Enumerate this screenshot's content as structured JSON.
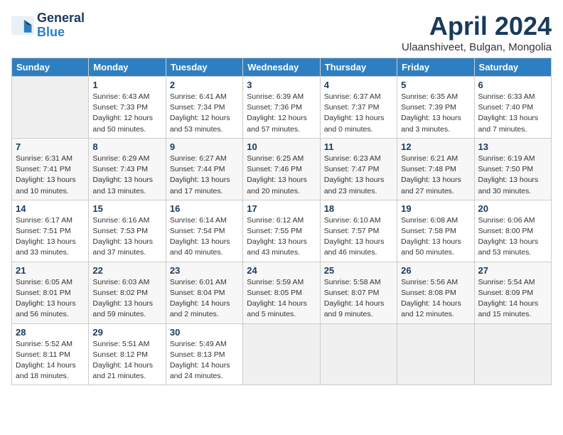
{
  "header": {
    "logo_line1": "General",
    "logo_line2": "Blue",
    "title": "April 2024",
    "subtitle": "Ulaanshiveet, Bulgan, Mongolia"
  },
  "weekdays": [
    "Sunday",
    "Monday",
    "Tuesday",
    "Wednesday",
    "Thursday",
    "Friday",
    "Saturday"
  ],
  "weeks": [
    [
      {
        "day": "",
        "info": ""
      },
      {
        "day": "1",
        "info": "Sunrise: 6:43 AM\nSunset: 7:33 PM\nDaylight: 12 hours\nand 50 minutes."
      },
      {
        "day": "2",
        "info": "Sunrise: 6:41 AM\nSunset: 7:34 PM\nDaylight: 12 hours\nand 53 minutes."
      },
      {
        "day": "3",
        "info": "Sunrise: 6:39 AM\nSunset: 7:36 PM\nDaylight: 12 hours\nand 57 minutes."
      },
      {
        "day": "4",
        "info": "Sunrise: 6:37 AM\nSunset: 7:37 PM\nDaylight: 13 hours\nand 0 minutes."
      },
      {
        "day": "5",
        "info": "Sunrise: 6:35 AM\nSunset: 7:39 PM\nDaylight: 13 hours\nand 3 minutes."
      },
      {
        "day": "6",
        "info": "Sunrise: 6:33 AM\nSunset: 7:40 PM\nDaylight: 13 hours\nand 7 minutes."
      }
    ],
    [
      {
        "day": "7",
        "info": "Sunrise: 6:31 AM\nSunset: 7:41 PM\nDaylight: 13 hours\nand 10 minutes."
      },
      {
        "day": "8",
        "info": "Sunrise: 6:29 AM\nSunset: 7:43 PM\nDaylight: 13 hours\nand 13 minutes."
      },
      {
        "day": "9",
        "info": "Sunrise: 6:27 AM\nSunset: 7:44 PM\nDaylight: 13 hours\nand 17 minutes."
      },
      {
        "day": "10",
        "info": "Sunrise: 6:25 AM\nSunset: 7:46 PM\nDaylight: 13 hours\nand 20 minutes."
      },
      {
        "day": "11",
        "info": "Sunrise: 6:23 AM\nSunset: 7:47 PM\nDaylight: 13 hours\nand 23 minutes."
      },
      {
        "day": "12",
        "info": "Sunrise: 6:21 AM\nSunset: 7:48 PM\nDaylight: 13 hours\nand 27 minutes."
      },
      {
        "day": "13",
        "info": "Sunrise: 6:19 AM\nSunset: 7:50 PM\nDaylight: 13 hours\nand 30 minutes."
      }
    ],
    [
      {
        "day": "14",
        "info": "Sunrise: 6:17 AM\nSunset: 7:51 PM\nDaylight: 13 hours\nand 33 minutes."
      },
      {
        "day": "15",
        "info": "Sunrise: 6:16 AM\nSunset: 7:53 PM\nDaylight: 13 hours\nand 37 minutes."
      },
      {
        "day": "16",
        "info": "Sunrise: 6:14 AM\nSunset: 7:54 PM\nDaylight: 13 hours\nand 40 minutes."
      },
      {
        "day": "17",
        "info": "Sunrise: 6:12 AM\nSunset: 7:55 PM\nDaylight: 13 hours\nand 43 minutes."
      },
      {
        "day": "18",
        "info": "Sunrise: 6:10 AM\nSunset: 7:57 PM\nDaylight: 13 hours\nand 46 minutes."
      },
      {
        "day": "19",
        "info": "Sunrise: 6:08 AM\nSunset: 7:58 PM\nDaylight: 13 hours\nand 50 minutes."
      },
      {
        "day": "20",
        "info": "Sunrise: 6:06 AM\nSunset: 8:00 PM\nDaylight: 13 hours\nand 53 minutes."
      }
    ],
    [
      {
        "day": "21",
        "info": "Sunrise: 6:05 AM\nSunset: 8:01 PM\nDaylight: 13 hours\nand 56 minutes."
      },
      {
        "day": "22",
        "info": "Sunrise: 6:03 AM\nSunset: 8:02 PM\nDaylight: 13 hours\nand 59 minutes."
      },
      {
        "day": "23",
        "info": "Sunrise: 6:01 AM\nSunset: 8:04 PM\nDaylight: 14 hours\nand 2 minutes."
      },
      {
        "day": "24",
        "info": "Sunrise: 5:59 AM\nSunset: 8:05 PM\nDaylight: 14 hours\nand 5 minutes."
      },
      {
        "day": "25",
        "info": "Sunrise: 5:58 AM\nSunset: 8:07 PM\nDaylight: 14 hours\nand 9 minutes."
      },
      {
        "day": "26",
        "info": "Sunrise: 5:56 AM\nSunset: 8:08 PM\nDaylight: 14 hours\nand 12 minutes."
      },
      {
        "day": "27",
        "info": "Sunrise: 5:54 AM\nSunset: 8:09 PM\nDaylight: 14 hours\nand 15 minutes."
      }
    ],
    [
      {
        "day": "28",
        "info": "Sunrise: 5:52 AM\nSunset: 8:11 PM\nDaylight: 14 hours\nand 18 minutes."
      },
      {
        "day": "29",
        "info": "Sunrise: 5:51 AM\nSunset: 8:12 PM\nDaylight: 14 hours\nand 21 minutes."
      },
      {
        "day": "30",
        "info": "Sunrise: 5:49 AM\nSunset: 8:13 PM\nDaylight: 14 hours\nand 24 minutes."
      },
      {
        "day": "",
        "info": ""
      },
      {
        "day": "",
        "info": ""
      },
      {
        "day": "",
        "info": ""
      },
      {
        "day": "",
        "info": ""
      }
    ]
  ]
}
